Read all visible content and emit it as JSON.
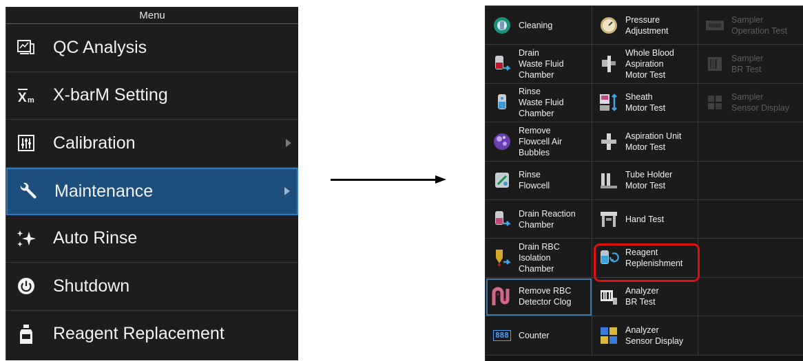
{
  "menu": {
    "header": "Menu",
    "items": [
      {
        "label": "QC Analysis",
        "icon": "qc-analysis-icon",
        "has_submenu": false,
        "selected": false
      },
      {
        "label": "X-barM Setting",
        "icon": "xbarm-icon",
        "has_submenu": false,
        "selected": false
      },
      {
        "label": "Calibration",
        "icon": "calibration-sliders-icon",
        "has_submenu": true,
        "selected": false
      },
      {
        "label": "Maintenance",
        "icon": "wrench-icon",
        "has_submenu": true,
        "selected": true
      },
      {
        "label": "Auto Rinse",
        "icon": "sparkle-icon",
        "has_submenu": false,
        "selected": false
      },
      {
        "label": "Shutdown",
        "icon": "power-icon",
        "has_submenu": false,
        "selected": false
      },
      {
        "label": "Reagent Replacement",
        "icon": "reagent-bottle-icon",
        "has_submenu": false,
        "selected": false
      }
    ]
  },
  "xbarm_icon_text": "X̅m",
  "maintenance": {
    "rows": [
      [
        {
          "label": "Cleaning",
          "icon": "cleaning-icon"
        },
        {
          "label": "Pressure\nAdjustment",
          "icon": "pressure-gauge-icon"
        },
        {
          "label": "Sampler\nOperation Test",
          "icon": "sampler-operation-icon",
          "disabled": true
        }
      ],
      [
        {
          "label": "Drain\nWaste Fluid\nChamber",
          "icon": "drain-waste-icon"
        },
        {
          "label": "Whole Blood\nAspiration\nMotor Test",
          "icon": "aspiration-motor-icon"
        },
        {
          "label": "Sampler\nBR Test",
          "icon": "sampler-br-icon",
          "disabled": true
        }
      ],
      [
        {
          "label": "Rinse\nWaste Fluid\nChamber",
          "icon": "rinse-waste-icon"
        },
        {
          "label": "Sheath\nMotor Test",
          "icon": "sheath-motor-icon"
        },
        {
          "label": "Sampler\nSensor Display",
          "icon": "sampler-sensor-icon",
          "disabled": true
        }
      ],
      [
        {
          "label": "Remove\nFlowcell Air\nBubbles",
          "icon": "flowcell-bubbles-icon"
        },
        {
          "label": "Aspiration Unit\nMotor Test",
          "icon": "aspiration-unit-icon"
        },
        null
      ],
      [
        {
          "label": "Rinse\nFlowcell",
          "icon": "rinse-flowcell-icon"
        },
        {
          "label": "Tube Holder\nMotor Test",
          "icon": "tube-holder-icon"
        },
        null
      ],
      [
        {
          "label": "Drain Reaction\nChamber",
          "icon": "drain-reaction-icon"
        },
        {
          "label": "Hand Test",
          "icon": "hand-test-icon"
        },
        null
      ],
      [
        {
          "label": "Drain RBC\nIsolation\nChamber",
          "icon": "drain-rbc-icon"
        },
        {
          "label": "Reagent\nReplenishment",
          "icon": "reagent-replenishment-icon",
          "highlighted": true
        },
        null
      ],
      [
        {
          "label": "Remove RBC\nDetector Clog",
          "icon": "rbc-clog-icon",
          "focused": true
        },
        {
          "label": "Analyzer\nBR Test",
          "icon": "barcode-reader-icon"
        },
        null
      ],
      [
        {
          "label": "Counter",
          "icon": "counter-icon",
          "icon_text": "888"
        },
        {
          "label": "Analyzer\nSensor Display",
          "icon": "sensor-display-icon"
        },
        null
      ]
    ]
  },
  "colors": {
    "selected_bg": "#1e4e7c",
    "highlight_border": "#e01010",
    "menu_bg": "#1d1d1d"
  }
}
